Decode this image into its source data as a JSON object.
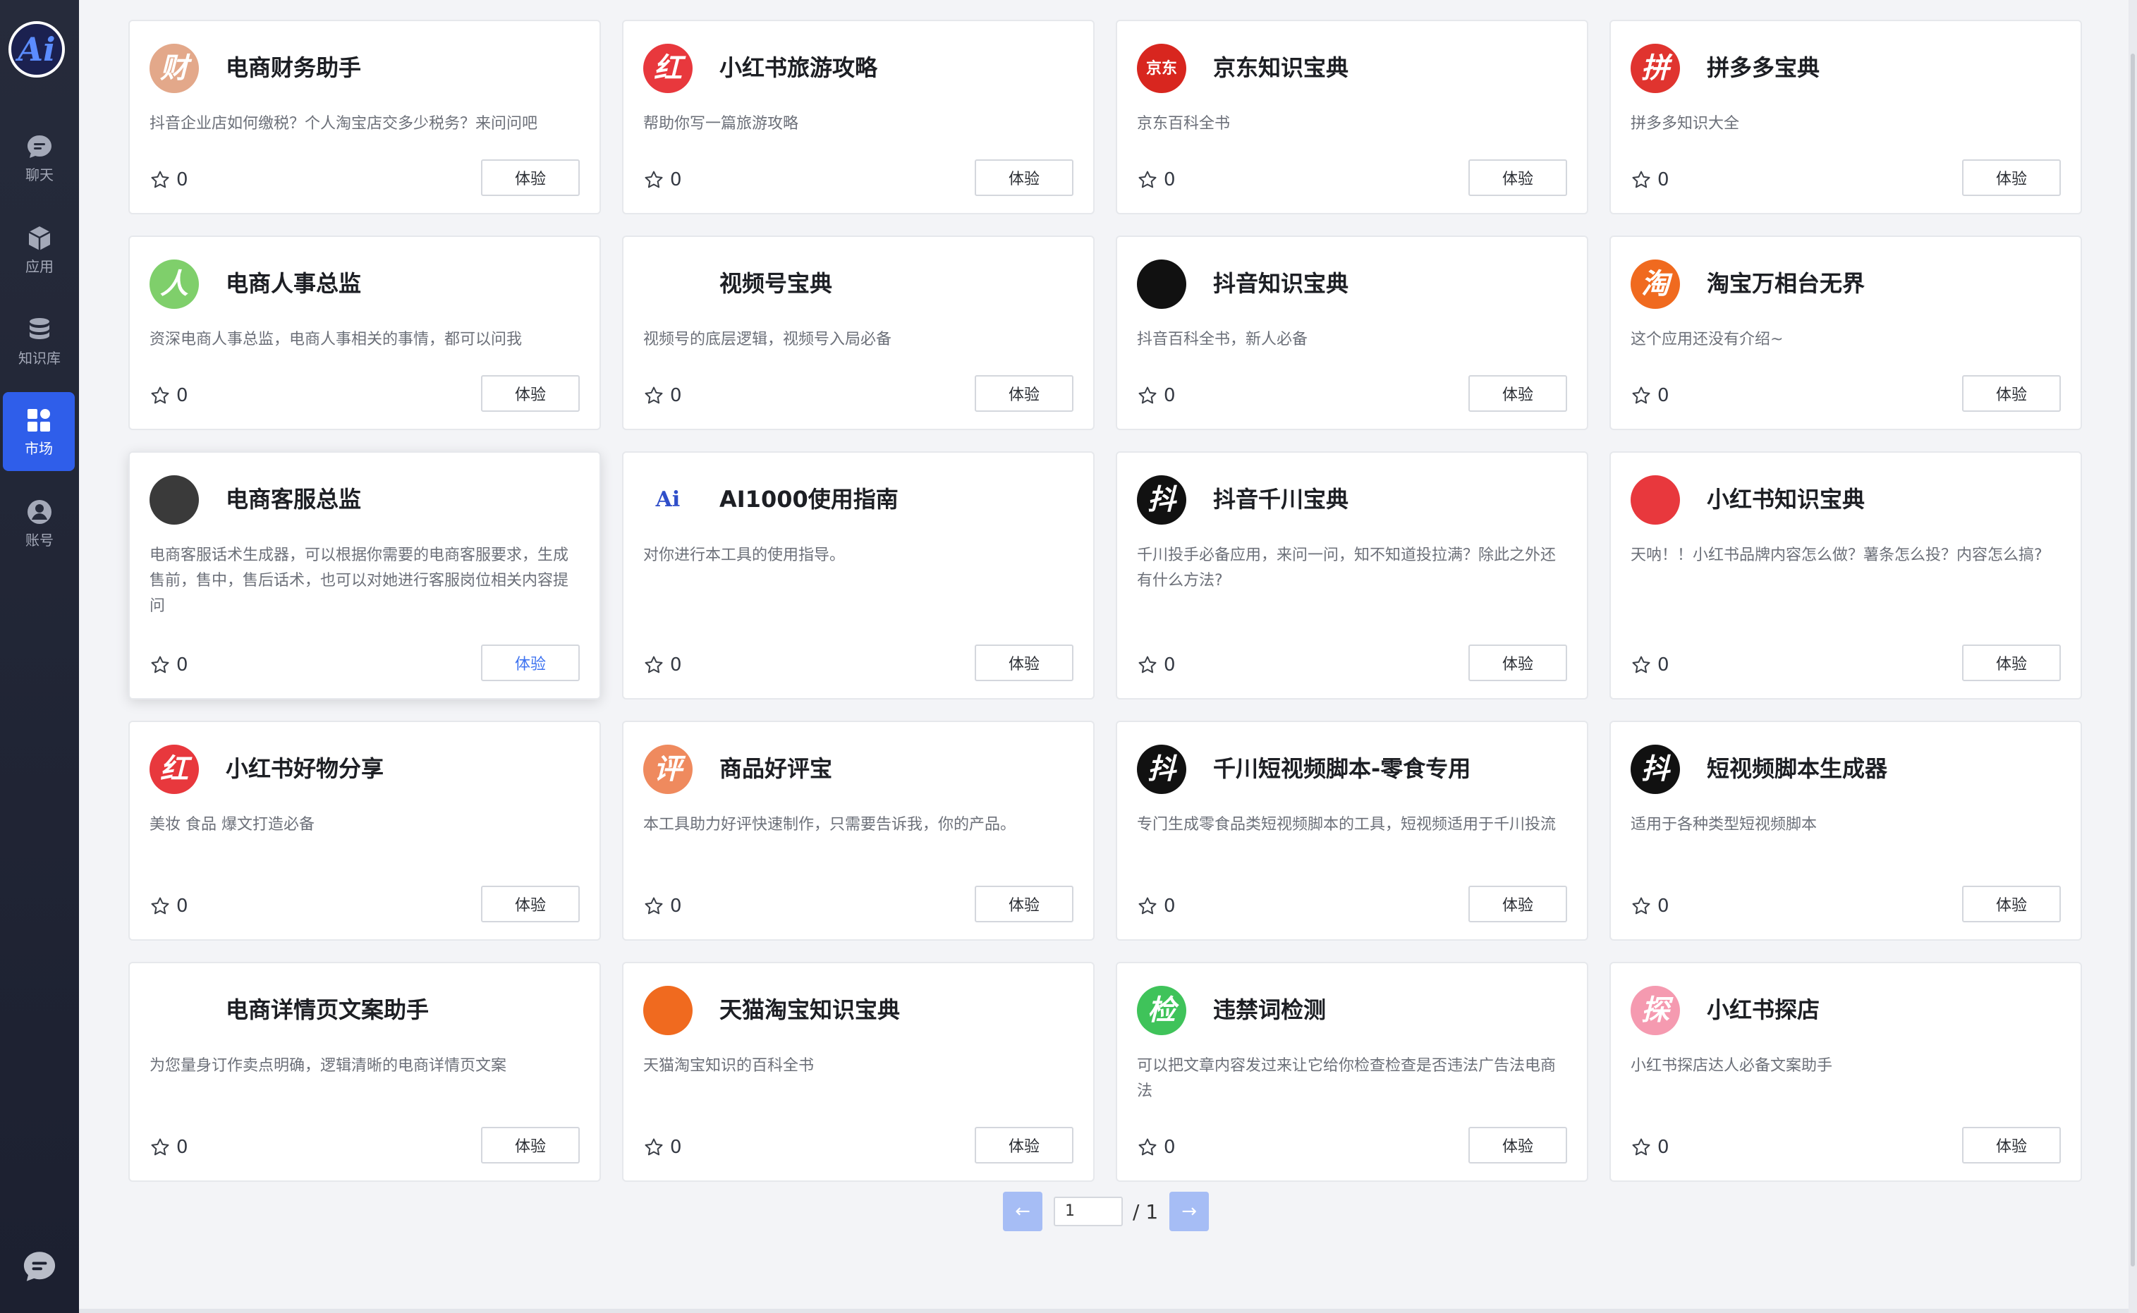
{
  "sidebar": {
    "logo": "Ai",
    "items": [
      {
        "label": "聊天",
        "icon": "chat-bubble-icon",
        "name": "chat"
      },
      {
        "label": "应用",
        "icon": "cube-icon",
        "name": "apps"
      },
      {
        "label": "知识库",
        "icon": "database-icon",
        "name": "knowledge"
      },
      {
        "label": "市场",
        "icon": "grid-icon",
        "name": "market"
      },
      {
        "label": "账号",
        "icon": "user-icon",
        "name": "account"
      }
    ]
  },
  "cards": [
    {
      "title": "电商财务助手",
      "desc": "抖音企业店如何缴税？个人淘宝店交多少税务？来问问吧",
      "stars": "0",
      "button": "体验",
      "icon": "cai-badge-icon",
      "glyph": "财",
      "color": "#e3a88a"
    },
    {
      "title": "小红书旅游攻略",
      "desc": "帮助你写一篇旅游攻略",
      "stars": "0",
      "button": "体验",
      "icon": "hong-badge-icon",
      "glyph": "红",
      "color": "#e8383d"
    },
    {
      "title": "京东知识宝典",
      "desc": "京东百科全书",
      "stars": "0",
      "button": "体验",
      "icon": "jd-dog-icon",
      "glyph": "京东",
      "color": "#d8261f"
    },
    {
      "title": "拼多多宝典",
      "desc": "拼多多知识大全",
      "stars": "0",
      "button": "体验",
      "icon": "pdd-heart-icon",
      "glyph": "拼",
      "color": "#e0342f"
    },
    {
      "title": "电商人事总监",
      "desc": "资深电商人事总监，电商人事相关的事情，都可以问我",
      "stars": "0",
      "button": "体验",
      "icon": "person-arrow-icon",
      "glyph": "人",
      "color": "#7fcf6b"
    },
    {
      "title": "视频号宝典",
      "desc": "视频号的底层逻辑，视频号入局必备",
      "stars": "0",
      "button": "体验",
      "icon": "channels-butterfly-icon",
      "glyph": "",
      "color": "#ffffff"
    },
    {
      "title": "抖音知识宝典",
      "desc": "抖音百科全书，新人必备",
      "stars": "0",
      "button": "体验",
      "icon": "douyin-book-icon",
      "glyph": "",
      "color": "#111111"
    },
    {
      "title": "淘宝万相台无界",
      "desc": "这个应用还没有介绍~",
      "stars": "0",
      "button": "体验",
      "icon": "tao-badge-icon",
      "glyph": "淘",
      "color": "#f06a1f"
    },
    {
      "title": "电商客服总监",
      "desc": "电商客服话术生成器，可以根据你需要的电商客服要求，生成售前，售中，售后话术，也可以对她进行客服岗位相关内容提问",
      "stars": "0",
      "button": "体验",
      "icon": "avatar-portrait-icon",
      "glyph": "",
      "color": "#3a3a3a"
    },
    {
      "title": "AI1000使用指南",
      "desc": "对你进行本工具的使用指导。",
      "stars": "0",
      "button": "体验",
      "icon": "ai1000-logo-icon",
      "glyph": "Ai",
      "color": "#ffffff"
    },
    {
      "title": "抖音千川宝典",
      "desc": "千川投手必备应用，来问一问，知不知道投拉满？除此之外还有什么方法?",
      "stars": "0",
      "button": "体验",
      "icon": "douyin-badge-icon",
      "glyph": "抖",
      "color": "#111111"
    },
    {
      "title": "小红书知识宝典",
      "desc": "天呐！！小红书品牌内容怎么做？薯条怎么投？内容怎么搞?",
      "stars": "0",
      "button": "体验",
      "icon": "xhs-book-icon",
      "glyph": "",
      "color": "#e8383d"
    },
    {
      "title": "小红书好物分享",
      "desc": "美妆 食品 爆文打造必备",
      "stars": "0",
      "button": "体验",
      "icon": "hong-badge-icon",
      "glyph": "红",
      "color": "#e8383d"
    },
    {
      "title": "商品好评宝",
      "desc": "本工具助力好评快速制作，只需要告诉我，你的产品。",
      "stars": "0",
      "button": "体验",
      "icon": "ping-badge-icon",
      "glyph": "评",
      "color": "#ef8a5e"
    },
    {
      "title": "千川短视频脚本-零食专用",
      "desc": "专门生成零食品类短视频脚本的工具，短视频适用于千川投流",
      "stars": "0",
      "button": "体验",
      "icon": "douyin-badge-icon",
      "glyph": "抖",
      "color": "#111111"
    },
    {
      "title": "短视频脚本生成器",
      "desc": "适用于各种类型短视频脚本",
      "stars": "0",
      "button": "体验",
      "icon": "douyin-badge-icon",
      "glyph": "抖",
      "color": "#111111"
    },
    {
      "title": "电商详情页文案助手",
      "desc": "为您量身订作卖点明确，逻辑清晰的电商详情页文案",
      "stars": "0",
      "button": "体验",
      "icon": "triangle-logo-icon",
      "glyph": "",
      "color": "#ffffff"
    },
    {
      "title": "天猫淘宝知识宝典",
      "desc": "天猫淘宝知识的百科全书",
      "stars": "0",
      "button": "体验",
      "icon": "tmall-book-icon",
      "glyph": "",
      "color": "#f06a1f"
    },
    {
      "title": "违禁词检测",
      "desc": "可以把文章内容发过来让它给你检查检查是否违法广告法电商法",
      "stars": "0",
      "button": "体验",
      "icon": "jian-badge-icon",
      "glyph": "检",
      "color": "#3fc35a"
    },
    {
      "title": "小红书探店",
      "desc": "小红书探店达人必备文案助手",
      "stars": "0",
      "button": "体验",
      "icon": "tan-badge-icon",
      "glyph": "探",
      "color": "#f59ab0"
    }
  ],
  "pagination": {
    "current": "1",
    "total": "/ 1",
    "prev": "←",
    "next": "→"
  }
}
